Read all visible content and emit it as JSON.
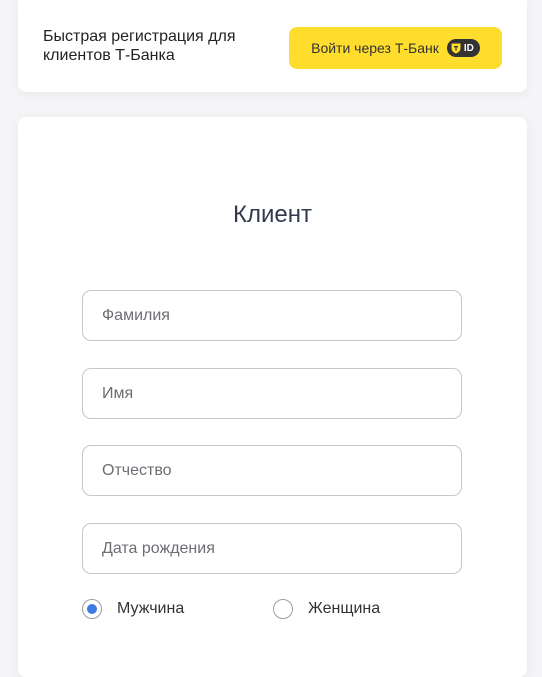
{
  "header": {
    "promo_text": "Быстрая регистрация для\nклиентов Т-Банка",
    "tbank_button_label": "Войти через Т-Банк",
    "id_badge_text": "ID"
  },
  "form": {
    "title": "Клиент",
    "fields": [
      {
        "placeholder": "Фамилия",
        "value": ""
      },
      {
        "placeholder": "Имя",
        "value": ""
      },
      {
        "placeholder": "Отчество",
        "value": ""
      },
      {
        "placeholder": "Дата рождения",
        "value": ""
      }
    ],
    "gender": {
      "options": [
        "Мужчина",
        "Женщина"
      ],
      "selected": "Мужчина"
    }
  },
  "colors": {
    "accent_yellow": "#ffdd2d",
    "radio_selected": "#3c7be0",
    "title_text": "#333a4d"
  }
}
